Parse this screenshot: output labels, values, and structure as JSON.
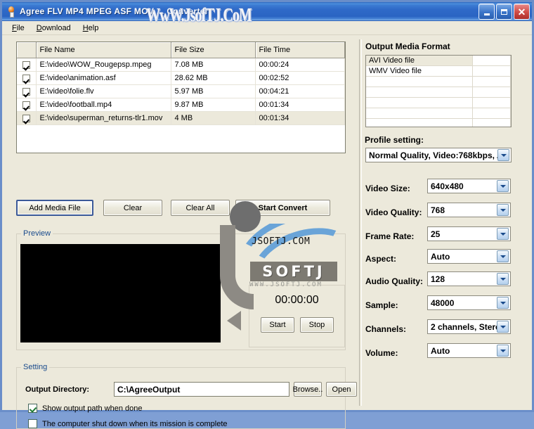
{
  "window": {
    "title": "Agree FLV MP4 MPEG ASF MOV ... Converter",
    "icon": "bulb-icon",
    "minimize_label": "Minimize",
    "maximize_label": "Maximize",
    "close_label": "Close"
  },
  "menu": [
    {
      "label": "File",
      "accel": "F"
    },
    {
      "label": "Download",
      "accel": "D"
    },
    {
      "label": "Help",
      "accel": "H"
    }
  ],
  "file_list": {
    "columns": [
      "",
      "File Name",
      "File Size",
      "File Time"
    ],
    "rows": [
      {
        "checked": true,
        "name": "E:\\video\\WOW_Rougepsp.mpeg",
        "size": "7.08 MB",
        "time": "00:00:24",
        "selected": false
      },
      {
        "checked": true,
        "name": "E:\\video\\animation.asf",
        "size": "28.62 MB",
        "time": "00:02:52",
        "selected": false
      },
      {
        "checked": true,
        "name": "E:\\video\\folie.flv",
        "size": "5.97 MB",
        "time": "00:04:21",
        "selected": false
      },
      {
        "checked": true,
        "name": "E:\\video\\football.mp4",
        "size": "9.87 MB",
        "time": "00:01:34",
        "selected": false
      },
      {
        "checked": true,
        "name": "E:\\video\\superman_returns-tlr1.mov",
        "size": "4 MB",
        "time": "00:01:34",
        "selected": true
      }
    ]
  },
  "actions": {
    "add_media": "Add Media File",
    "clear": "Clear",
    "clear_all": "Clear All",
    "start_convert": "Start Convert"
  },
  "preview": {
    "legend": "Preview",
    "timer": "00:00:00",
    "start": "Start",
    "stop": "Stop"
  },
  "setting": {
    "legend": "Setting",
    "output_directory_label": "Output Directory:",
    "output_directory_value": "C:\\AgreeOutput",
    "browse": "Browse..",
    "open": "Open",
    "show_output_path": {
      "label": "Show output path when done",
      "checked": true
    },
    "shutdown": {
      "label": "The computer shut down when its mission is complete",
      "checked": false
    }
  },
  "output_format": {
    "title": "Output Media Format",
    "items": [
      {
        "label": "AVI Video file",
        "selected": true
      },
      {
        "label": "WMV Video file",
        "selected": false
      },
      {
        "label": "",
        "selected": false
      },
      {
        "label": "",
        "selected": false
      },
      {
        "label": "",
        "selected": false
      },
      {
        "label": "",
        "selected": false
      },
      {
        "label": "",
        "selected": false
      }
    ],
    "profile_label": "Profile setting:",
    "profile_value": "Normal Quality, Video:768kbps, A"
  },
  "settings_rows": [
    {
      "label": "Video Size:",
      "value": "640x480"
    },
    {
      "label": "Video Quality:",
      "value": "768"
    },
    {
      "label": "Frame Rate:",
      "value": "25"
    },
    {
      "label": "Aspect:",
      "value": "Auto"
    },
    {
      "label": "Audio Quality:",
      "value": "128"
    },
    {
      "label": "Sample:",
      "value": "48000"
    },
    {
      "label": "Channels:",
      "value": "2 channels, Stere"
    },
    {
      "label": "Volume:",
      "value": "Auto"
    }
  ],
  "watermarks": {
    "top": "WwW.JsofTJ.CoM",
    "jsoftj_dot_com": "JSOFTJ.COM",
    "softj": "SOFTJ",
    "url": "WWW.JSOFTJ.COM"
  },
  "colors": {
    "background": "#ece9db",
    "titlebar": "#2f6ac0",
    "legend_text": "#1a4b8c",
    "selection": "#ece9db"
  }
}
